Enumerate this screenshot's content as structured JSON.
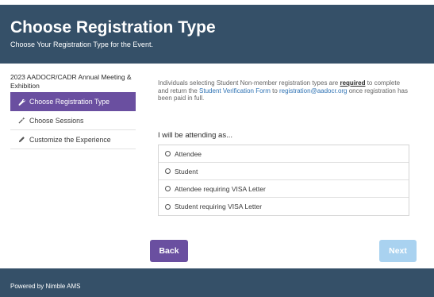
{
  "header": {
    "title": "Choose Registration Type",
    "subtitle": "Choose Your Registration Type for the Event."
  },
  "sidebar": {
    "event_name": "2023 AADOCR/CADR Annual Meeting & Exhibition",
    "items": [
      {
        "label": "Choose Registration Type",
        "icon": "wrench-icon",
        "active": true
      },
      {
        "label": "Choose Sessions",
        "icon": "wand-icon",
        "active": false
      },
      {
        "label": "Customize the Experience",
        "icon": "pencil-icon",
        "active": false
      }
    ]
  },
  "info": {
    "part1": "Individuals selecting Student Non-member registration types are ",
    "required": "required",
    "part2": " to complete and return the ",
    "form_link": "Student Verification Form",
    "part3": " to ",
    "email_link": "registration@aadocr.org",
    "part4": " once registration has been paid in full."
  },
  "attending": {
    "label": "I will be attending as...",
    "options": [
      "Attendee",
      "Student",
      "Attendee requiring VISA Letter",
      "Student requiring VISA Letter"
    ]
  },
  "buttons": {
    "back": "Back",
    "next": "Next"
  },
  "footer": {
    "text": "Powered by Nimble AMS"
  },
  "colors": {
    "header_bg": "#355068",
    "accent": "#6a4fa0",
    "link": "#2f73b4",
    "next_disabled": "#a9d2f0"
  }
}
